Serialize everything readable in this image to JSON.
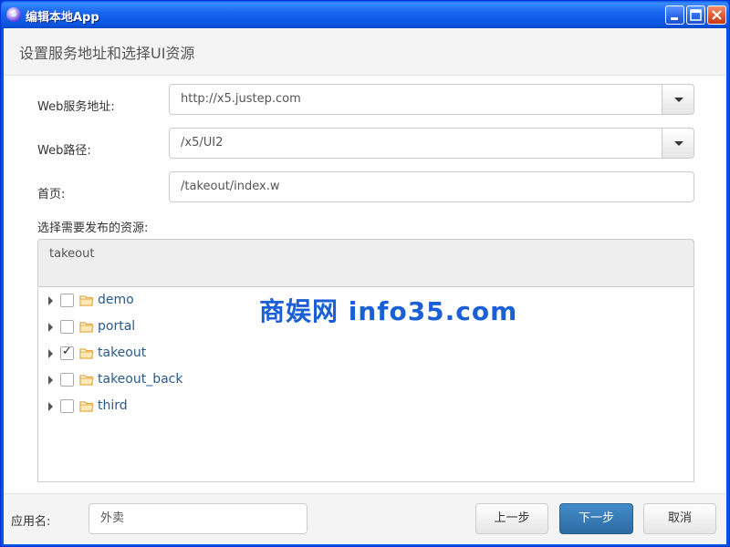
{
  "window": {
    "title": "编辑本地App",
    "icon": "app-logo-icon"
  },
  "header": {
    "title": "设置服务地址和选择UI资源"
  },
  "form": {
    "web_service_label": "Web服务地址:",
    "web_service_value": "http://x5.justep.com",
    "web_path_label": "Web路径:",
    "web_path_value": "/x5/UI2",
    "home_label": "首页:",
    "home_value": "/takeout/index.w",
    "resources_label": "选择需要发布的资源:"
  },
  "selected_resource": "takeout",
  "tree": {
    "nodes": [
      {
        "label": "demo",
        "checked": false
      },
      {
        "label": "portal",
        "checked": false
      },
      {
        "label": "takeout",
        "checked": true
      },
      {
        "label": "takeout_back",
        "checked": false
      },
      {
        "label": "third",
        "checked": false
      }
    ]
  },
  "footer": {
    "app_name_label": "应用名:",
    "app_name_value": "外卖",
    "prev_label": "上一步",
    "next_label": "下一步",
    "cancel_label": "取消"
  },
  "watermark": "商娱网 info35.com",
  "colors": {
    "primary": "#337ab7",
    "titlebar": "#0a54e0",
    "tree_label": "#2a5a8a"
  }
}
